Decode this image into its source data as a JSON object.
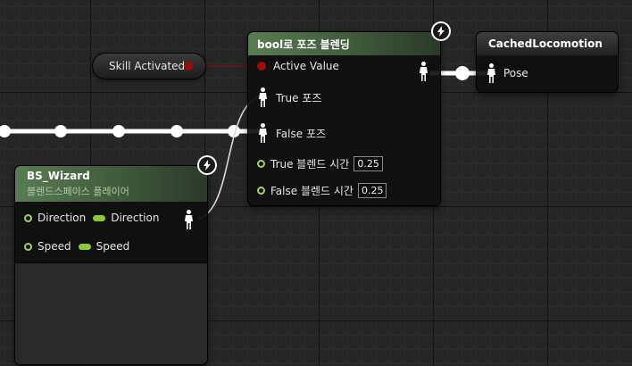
{
  "skill_node": {
    "label": "Skill Activated"
  },
  "blend_node": {
    "title": "bool로 포즈 블렌딩",
    "active_value": "Active Value",
    "true_pose": "True 포즈",
    "false_pose": "False 포즈",
    "true_blend_label": "True 블렌드 시간",
    "true_blend_value": "0.25",
    "false_blend_label": "False 블렌드 시간",
    "false_blend_value": "0.25"
  },
  "cached_node": {
    "title": "CachedLocomotion",
    "pose": "Pose"
  },
  "bs_node": {
    "title": "BS_Wizard",
    "subtitle": "블렌드스페이스 플레이어",
    "direction_label": "Direction",
    "direction_var": "Direction",
    "speed_label": "Speed",
    "speed_var": "Speed"
  },
  "colors": {
    "grid_bg": "#262626",
    "green_header": "#5a7c54",
    "bool_pin": "#9a0d0d",
    "float_pin": "#8fc93a",
    "exec_wire": "#ffffff"
  },
  "icons": {
    "fast_path": "lightning-icon",
    "pose_pin": "pose-person-icon"
  }
}
